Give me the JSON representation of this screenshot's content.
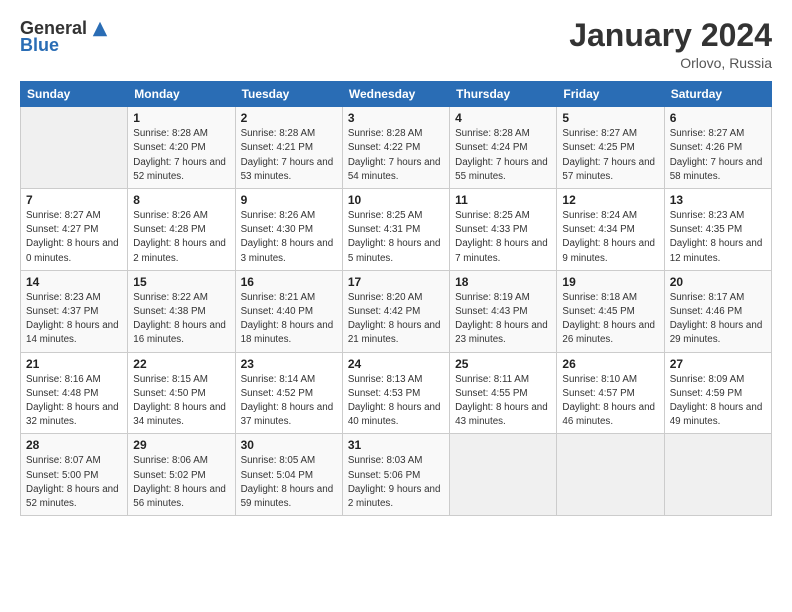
{
  "logo": {
    "general": "General",
    "blue": "Blue"
  },
  "calendar": {
    "title": "January 2024",
    "subtitle": "Orlovo, Russia"
  },
  "weekdays": [
    "Sunday",
    "Monday",
    "Tuesday",
    "Wednesday",
    "Thursday",
    "Friday",
    "Saturday"
  ],
  "weeks": [
    [
      {
        "day": "",
        "detail": ""
      },
      {
        "day": "1",
        "detail": "Sunrise: 8:28 AM\nSunset: 4:20 PM\nDaylight: 7 hours\nand 52 minutes."
      },
      {
        "day": "2",
        "detail": "Sunrise: 8:28 AM\nSunset: 4:21 PM\nDaylight: 7 hours\nand 53 minutes."
      },
      {
        "day": "3",
        "detail": "Sunrise: 8:28 AM\nSunset: 4:22 PM\nDaylight: 7 hours\nand 54 minutes."
      },
      {
        "day": "4",
        "detail": "Sunrise: 8:28 AM\nSunset: 4:24 PM\nDaylight: 7 hours\nand 55 minutes."
      },
      {
        "day": "5",
        "detail": "Sunrise: 8:27 AM\nSunset: 4:25 PM\nDaylight: 7 hours\nand 57 minutes."
      },
      {
        "day": "6",
        "detail": "Sunrise: 8:27 AM\nSunset: 4:26 PM\nDaylight: 7 hours\nand 58 minutes."
      }
    ],
    [
      {
        "day": "7",
        "detail": "Sunrise: 8:27 AM\nSunset: 4:27 PM\nDaylight: 8 hours\nand 0 minutes."
      },
      {
        "day": "8",
        "detail": "Sunrise: 8:26 AM\nSunset: 4:28 PM\nDaylight: 8 hours\nand 2 minutes."
      },
      {
        "day": "9",
        "detail": "Sunrise: 8:26 AM\nSunset: 4:30 PM\nDaylight: 8 hours\nand 3 minutes."
      },
      {
        "day": "10",
        "detail": "Sunrise: 8:25 AM\nSunset: 4:31 PM\nDaylight: 8 hours\nand 5 minutes."
      },
      {
        "day": "11",
        "detail": "Sunrise: 8:25 AM\nSunset: 4:33 PM\nDaylight: 8 hours\nand 7 minutes."
      },
      {
        "day": "12",
        "detail": "Sunrise: 8:24 AM\nSunset: 4:34 PM\nDaylight: 8 hours\nand 9 minutes."
      },
      {
        "day": "13",
        "detail": "Sunrise: 8:23 AM\nSunset: 4:35 PM\nDaylight: 8 hours\nand 12 minutes."
      }
    ],
    [
      {
        "day": "14",
        "detail": "Sunrise: 8:23 AM\nSunset: 4:37 PM\nDaylight: 8 hours\nand 14 minutes."
      },
      {
        "day": "15",
        "detail": "Sunrise: 8:22 AM\nSunset: 4:38 PM\nDaylight: 8 hours\nand 16 minutes."
      },
      {
        "day": "16",
        "detail": "Sunrise: 8:21 AM\nSunset: 4:40 PM\nDaylight: 8 hours\nand 18 minutes."
      },
      {
        "day": "17",
        "detail": "Sunrise: 8:20 AM\nSunset: 4:42 PM\nDaylight: 8 hours\nand 21 minutes."
      },
      {
        "day": "18",
        "detail": "Sunrise: 8:19 AM\nSunset: 4:43 PM\nDaylight: 8 hours\nand 23 minutes."
      },
      {
        "day": "19",
        "detail": "Sunrise: 8:18 AM\nSunset: 4:45 PM\nDaylight: 8 hours\nand 26 minutes."
      },
      {
        "day": "20",
        "detail": "Sunrise: 8:17 AM\nSunset: 4:46 PM\nDaylight: 8 hours\nand 29 minutes."
      }
    ],
    [
      {
        "day": "21",
        "detail": "Sunrise: 8:16 AM\nSunset: 4:48 PM\nDaylight: 8 hours\nand 32 minutes."
      },
      {
        "day": "22",
        "detail": "Sunrise: 8:15 AM\nSunset: 4:50 PM\nDaylight: 8 hours\nand 34 minutes."
      },
      {
        "day": "23",
        "detail": "Sunrise: 8:14 AM\nSunset: 4:52 PM\nDaylight: 8 hours\nand 37 minutes."
      },
      {
        "day": "24",
        "detail": "Sunrise: 8:13 AM\nSunset: 4:53 PM\nDaylight: 8 hours\nand 40 minutes."
      },
      {
        "day": "25",
        "detail": "Sunrise: 8:11 AM\nSunset: 4:55 PM\nDaylight: 8 hours\nand 43 minutes."
      },
      {
        "day": "26",
        "detail": "Sunrise: 8:10 AM\nSunset: 4:57 PM\nDaylight: 8 hours\nand 46 minutes."
      },
      {
        "day": "27",
        "detail": "Sunrise: 8:09 AM\nSunset: 4:59 PM\nDaylight: 8 hours\nand 49 minutes."
      }
    ],
    [
      {
        "day": "28",
        "detail": "Sunrise: 8:07 AM\nSunset: 5:00 PM\nDaylight: 8 hours\nand 52 minutes."
      },
      {
        "day": "29",
        "detail": "Sunrise: 8:06 AM\nSunset: 5:02 PM\nDaylight: 8 hours\nand 56 minutes."
      },
      {
        "day": "30",
        "detail": "Sunrise: 8:05 AM\nSunset: 5:04 PM\nDaylight: 8 hours\nand 59 minutes."
      },
      {
        "day": "31",
        "detail": "Sunrise: 8:03 AM\nSunset: 5:06 PM\nDaylight: 9 hours\nand 2 minutes."
      },
      {
        "day": "",
        "detail": ""
      },
      {
        "day": "",
        "detail": ""
      },
      {
        "day": "",
        "detail": ""
      }
    ]
  ]
}
